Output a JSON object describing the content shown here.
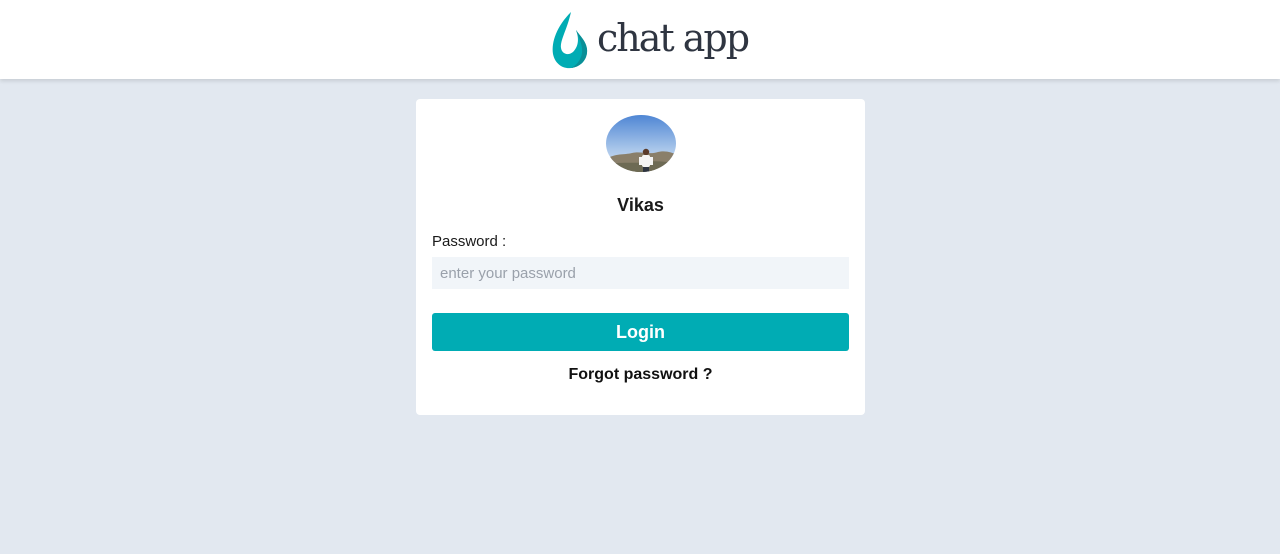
{
  "header": {
    "logo_text": "chat app",
    "logo_icon": "flame-drop-icon",
    "brand_color": "#00acb4"
  },
  "login_card": {
    "avatar": "user-avatar-photo",
    "username": "Vikas",
    "password_label": "Password :",
    "password_placeholder": "enter your password",
    "password_value": "",
    "login_label": "Login",
    "forgot_label": "Forgot password ?"
  },
  "colors": {
    "page_background": "#e2e8f0",
    "card_background": "#ffffff",
    "button": "#00acb4",
    "input_background": "#f1f5f9"
  }
}
